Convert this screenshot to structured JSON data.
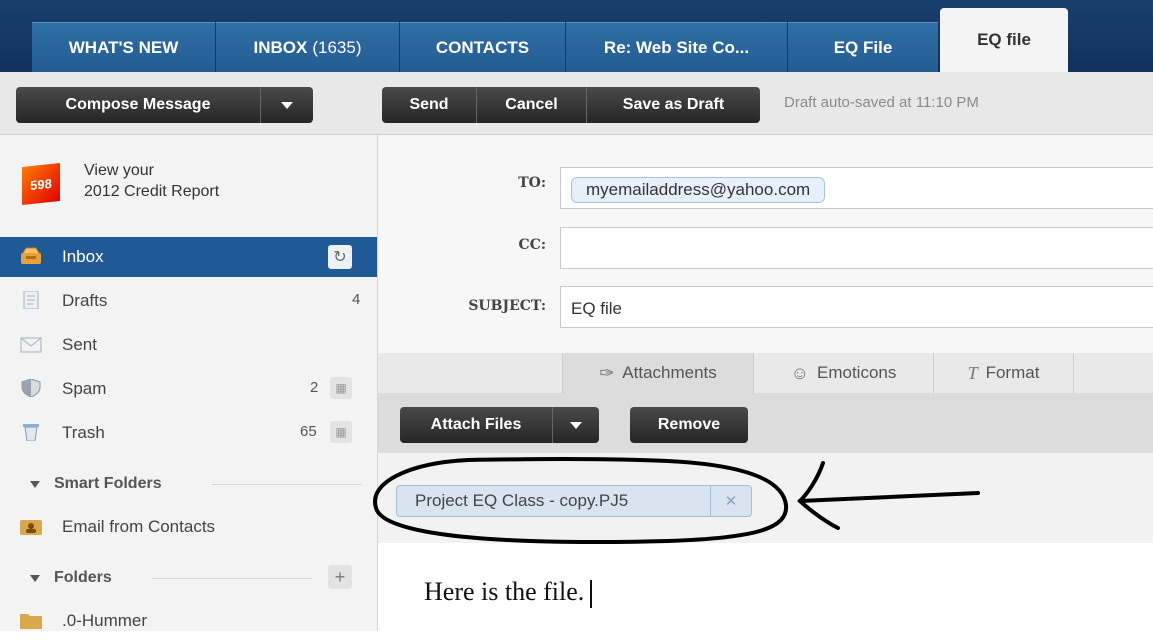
{
  "tabs": [
    {
      "label": "WHAT'S NEW"
    },
    {
      "label": "INBOX",
      "count": "(1635)"
    },
    {
      "label": "CONTACTS"
    },
    {
      "label": "Re: Web Site Co..."
    },
    {
      "label": "EQ File"
    },
    {
      "label": "EQ file"
    }
  ],
  "toolbar": {
    "compose_label": "Compose Message",
    "send_label": "Send",
    "cancel_label": "Cancel",
    "save_draft_label": "Save as Draft",
    "autosave_text": "Draft auto-saved at 11:10 PM"
  },
  "ad": {
    "logo_text": "598",
    "line1": "View your",
    "line2": "2012 Credit Report"
  },
  "folders": [
    {
      "label": "Inbox",
      "count": ""
    },
    {
      "label": "Drafts",
      "count": "4"
    },
    {
      "label": "Sent",
      "count": ""
    },
    {
      "label": "Spam",
      "count": "2"
    },
    {
      "label": "Trash",
      "count": "65"
    }
  ],
  "smart_folders": {
    "heading": "Smart Folders",
    "items": [
      {
        "label": "Email from Contacts"
      }
    ]
  },
  "user_folders": {
    "heading": "Folders",
    "items": [
      {
        "label": ".0-Hummer"
      }
    ]
  },
  "compose": {
    "to_label": "TO:",
    "to_value": "myemailaddress@yahoo.com",
    "cc_label": "CC:",
    "cc_value": "",
    "subject_label": "SUBJECT:",
    "subject_value": "EQ file",
    "tabs": [
      {
        "label": "Attachments",
        "icon": "paperclip-icon"
      },
      {
        "label": "Emoticons",
        "icon": "smiley-icon"
      },
      {
        "label": "Format",
        "icon": "format-icon"
      }
    ],
    "attach_files_label": "Attach Files",
    "remove_label": "Remove",
    "attachment_name": "Project EQ Class - copy.PJ5",
    "body_text": "Here is the file."
  },
  "colors": {
    "tabbar": "#0f2f5a",
    "tab": "#2f6ea6",
    "selected_folder": "#1f5a96",
    "dark_button": "#2b2b2b"
  }
}
